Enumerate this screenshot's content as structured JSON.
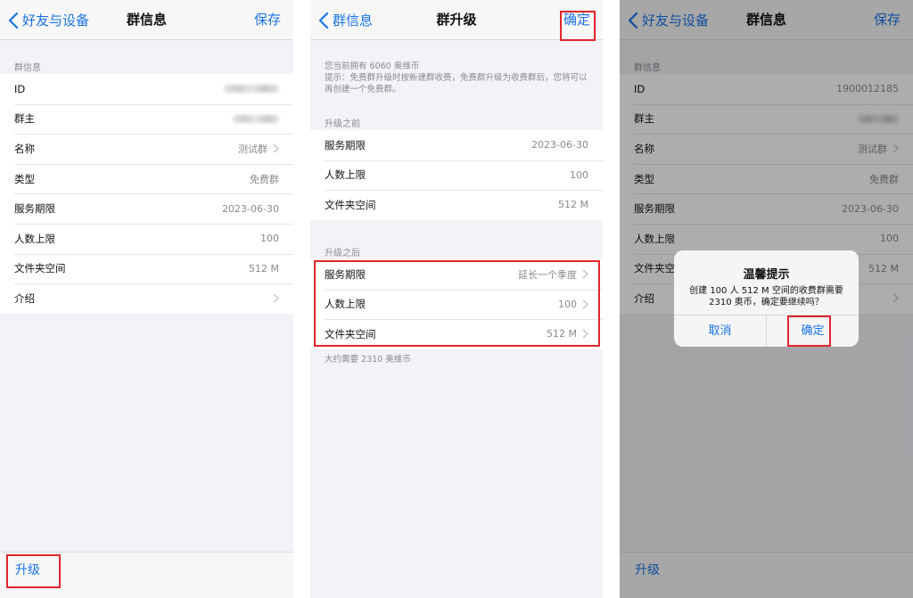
{
  "colors": {
    "accent": "#1a73e8",
    "highlight": "#e3242b",
    "background": "#f2f2f7"
  },
  "screen1": {
    "nav": {
      "back_label": "好友与设备",
      "title": "群信息",
      "right_label": "保存"
    },
    "section_header": "群信息",
    "rows": [
      {
        "label": "ID",
        "value": ""
      },
      {
        "label": "群主",
        "value": ""
      },
      {
        "label": "名称",
        "value": "测试群"
      },
      {
        "label": "类型",
        "value": "免费群"
      },
      {
        "label": "服务期限",
        "value": "2023-06-30"
      },
      {
        "label": "人数上限",
        "value": "100"
      },
      {
        "label": "文件夹空间",
        "value": "512 M"
      },
      {
        "label": "介绍",
        "value": ""
      }
    ],
    "bottom_action": "升级"
  },
  "screen2": {
    "nav": {
      "back_label": "群信息",
      "title": "群升级",
      "right_label": "确定"
    },
    "note_balance": "您当前拥有 6060 奥维币",
    "note_tip": "提示：免费群升级时按新建群收费，免费群升级为收费群后，您将可以再创建一个免费群。",
    "before_header": "升级之前",
    "before_rows": [
      {
        "label": "服务期限",
        "value": "2023-06-30"
      },
      {
        "label": "人数上限",
        "value": "100"
      },
      {
        "label": "文件夹空间",
        "value": "512 M"
      }
    ],
    "after_header": "升级之后",
    "after_rows": [
      {
        "label": "服务期限",
        "value": "延长一个季度"
      },
      {
        "label": "人数上限",
        "value": "100"
      },
      {
        "label": "文件夹空间",
        "value": "512 M"
      }
    ],
    "cost_note": "大约需要 2310 奥维币"
  },
  "screen3": {
    "nav": {
      "back_label": "好友与设备",
      "title": "群信息",
      "right_label": "保存"
    },
    "section_header": "群信息",
    "rows": [
      {
        "label": "ID",
        "value": "1900012185"
      },
      {
        "label": "群主",
        "value": ""
      },
      {
        "label": "名称",
        "value": "测试群"
      },
      {
        "label": "类型",
        "value": "免费群"
      },
      {
        "label": "服务期限",
        "value": "2023-06-30"
      },
      {
        "label": "人数上限",
        "value": "100"
      },
      {
        "label": "文件夹空间",
        "value": "512 M"
      },
      {
        "label": "介绍",
        "value": ""
      }
    ],
    "bottom_action": "升级",
    "alert": {
      "title": "温馨提示",
      "message": "创建 100 人 512 M 空间的收费群需要 2310 奥币，确定要继续吗？",
      "cancel_label": "取消",
      "confirm_label": "确定"
    }
  }
}
